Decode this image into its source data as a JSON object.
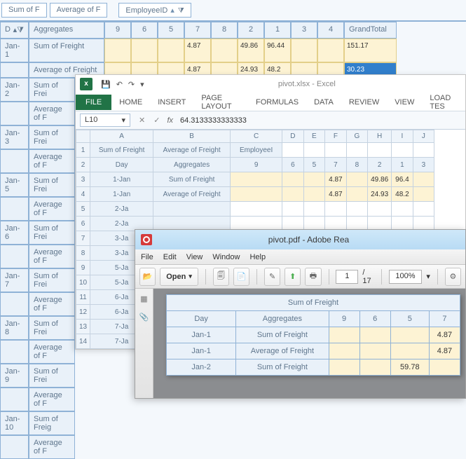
{
  "pivot": {
    "chips": {
      "sumF": "Sum of F",
      "avgF": "Average of F",
      "empId": "EmployeeID"
    },
    "headers": {
      "dayShort": "D",
      "aggregates": "Aggregates",
      "cols": [
        "9",
        "6",
        "5",
        "7",
        "8",
        "2",
        "1",
        "3",
        "4"
      ],
      "grandTotal": "GrandTotal"
    },
    "rowLabels": {
      "sumOfFreight": "Sum of Freight",
      "averageOfFreight": "Average of Freight",
      "sumOfFrei": "Sum of Frei",
      "averageOfF": "Average of F",
      "sumOfFreig": "Sum of Freig"
    },
    "days": [
      "Jan-1",
      "Jan-2",
      "Jan-3",
      "Jan-5",
      "Jan-6",
      "Jan-7",
      "Jan-8",
      "Jan-9",
      "Jan-10"
    ],
    "dataRow1": {
      "c7": "4.87",
      "c2": "49.86",
      "c1": "96.44",
      "gt": "151.17"
    },
    "dataRow2": {
      "c7": "4.87",
      "c2": "24.93",
      "c1": "48.2",
      "gt": "30.23"
    }
  },
  "excel": {
    "app": "Excel",
    "docName": "pivot.xlsx - Excel",
    "ribbon": {
      "file": "FILE",
      "home": "HOME",
      "insert": "INSERT",
      "pageLayout": "PAGE LAYOUT",
      "formulas": "FORMULAS",
      "data": "DATA",
      "review": "REVIEW",
      "view": "VIEW",
      "loadTest": "LOAD TES"
    },
    "nameBox": "L10",
    "fxValue": "64.3133333333333",
    "colHeaders": [
      "A",
      "B",
      "C",
      "D",
      "E",
      "F",
      "G",
      "H",
      "I",
      "J"
    ],
    "rowHeaders": [
      "1",
      "2",
      "3",
      "4",
      "5",
      "6",
      "7",
      "8",
      "9",
      "10",
      "11",
      "12",
      "13",
      "14"
    ],
    "cells": {
      "r1": {
        "A": "Sum of Freight",
        "B": "Average of Freight",
        "C": "EmployeeI"
      },
      "r2": {
        "A": "Day",
        "B": "Aggregates",
        "C": "9",
        "D": "6",
        "E": "5",
        "F": "7",
        "G": "8",
        "H": "2",
        "I": "1",
        "J": "3"
      },
      "r3": {
        "A": "1-Jan",
        "B": "Sum of Freight",
        "F": "4.87",
        "H": "49.86",
        "I": "96.4"
      },
      "r4": {
        "A": "1-Jan",
        "B": "Average of Freight",
        "F": "4.87",
        "H": "24.93",
        "I": "48.2"
      },
      "r5": {
        "A": "2-Ja"
      },
      "r6": {
        "A": "2-Ja"
      },
      "r7": {
        "A": "3-Ja"
      },
      "r8": {
        "A": "3-Ja"
      },
      "r9": {
        "A": "5-Ja"
      },
      "r10": {
        "A": "5-Ja"
      },
      "r11": {
        "A": "6-Ja"
      },
      "r12": {
        "A": "6-Ja"
      },
      "r13": {
        "A": "7-Ja"
      },
      "r14": {
        "A": "7-Ja"
      }
    }
  },
  "pdf": {
    "title": "pivot.pdf - Adobe Rea",
    "menu": {
      "file": "File",
      "edit": "Edit",
      "view": "View",
      "window": "Window",
      "help": "Help"
    },
    "toolbar": {
      "open": "Open",
      "page": "1",
      "pages": "/ 17",
      "zoom": "100%"
    },
    "table": {
      "title": "Sum of Freight",
      "hDay": "Day",
      "hAgg": "Aggregates",
      "cols": [
        "9",
        "6",
        "5",
        "7"
      ],
      "rows": [
        {
          "day": "Jan-1",
          "agg": "Sum of Freight",
          "vals": [
            "",
            "",
            "",
            "4.87"
          ]
        },
        {
          "day": "Jan-1",
          "agg": "Average of Freight",
          "vals": [
            "",
            "",
            "",
            "4.87"
          ]
        },
        {
          "day": "Jan-2",
          "agg": "Sum of Freight",
          "vals": [
            "",
            "",
            "59.78",
            ""
          ]
        }
      ]
    }
  }
}
